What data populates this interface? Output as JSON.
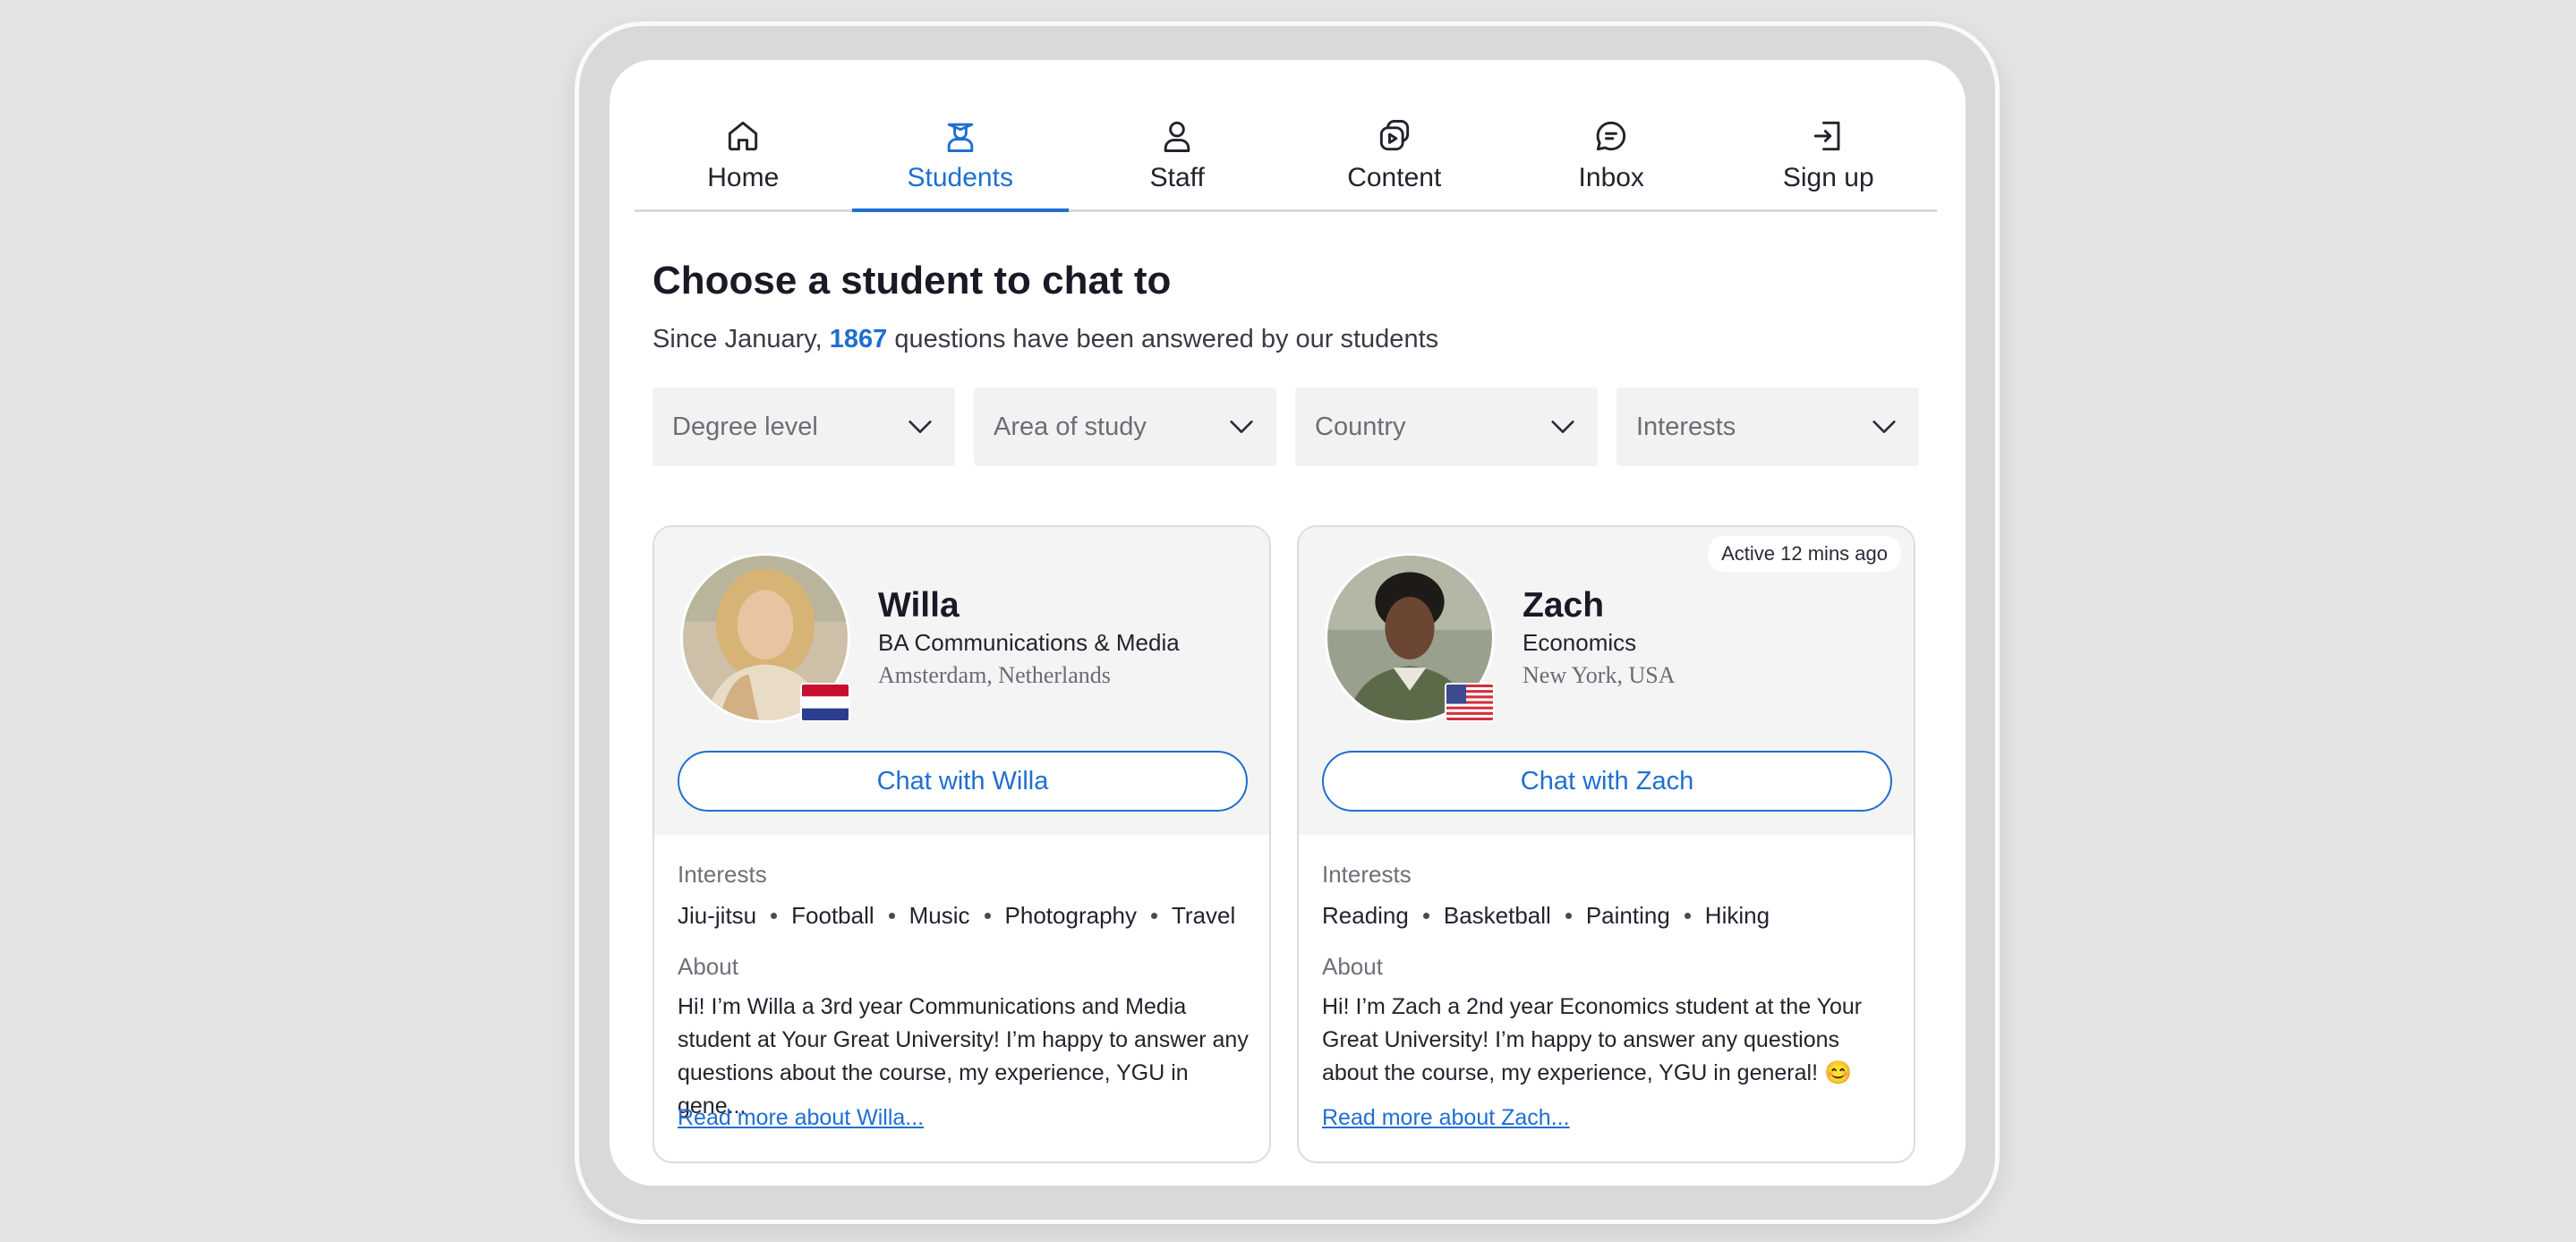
{
  "nav": {
    "tabs": [
      {
        "label": "Home",
        "icon": "home-icon"
      },
      {
        "label": "Students",
        "icon": "graduate-icon"
      },
      {
        "label": "Staff",
        "icon": "person-icon"
      },
      {
        "label": "Content",
        "icon": "content-icon"
      },
      {
        "label": "Inbox",
        "icon": "chat-bubble-icon"
      },
      {
        "label": "Sign up",
        "icon": "sign-in-icon"
      }
    ],
    "active_tab": "Students"
  },
  "page": {
    "title": "Choose a student to chat to",
    "subtitle_prefix": "Since January,",
    "question_count": "1867",
    "subtitle_suffix": "questions have been answered by our students"
  },
  "filters": [
    {
      "placeholder": "Degree level"
    },
    {
      "placeholder": "Area of study"
    },
    {
      "placeholder": "Country"
    },
    {
      "placeholder": "Interests"
    }
  ],
  "students": [
    {
      "name": "Willa",
      "degree": "BA Communications & Media",
      "location": "Amsterdam, Netherlands",
      "flag": "netherlands-flag",
      "chat_label": "Chat with Willa",
      "interests_label": "Interests",
      "interests": [
        "Jiu-jitsu",
        "Football",
        "Music",
        "Photography",
        "Travel"
      ],
      "about_label": "About",
      "about": "Hi! I’m Willa a 3rd year Communications and Media student at Your Great University! I’m happy to answer any questions about the course, my experience, YGU in gene...",
      "read_more": "Read more about Willa..."
    },
    {
      "name": "Zach",
      "degree": "Economics",
      "location": "New York, USA",
      "flag": "usa-flag",
      "active_status": "Active 12 mins ago",
      "chat_label": "Chat with Zach",
      "interests_label": "Interests",
      "interests": [
        "Reading",
        "Basketball",
        "Painting",
        "Hiking"
      ],
      "about_label": "About",
      "about": "Hi! I’m Zach a 2nd year Economics student at the Your Great University! I’m happy to answer any questions about the course, my experience, YGU in general! 😊",
      "read_more": "Read more about Zach..."
    }
  ],
  "colors": {
    "accent": "#1f6fd0",
    "background": "#e4e4e4",
    "card_top": "#f4f4f4"
  }
}
